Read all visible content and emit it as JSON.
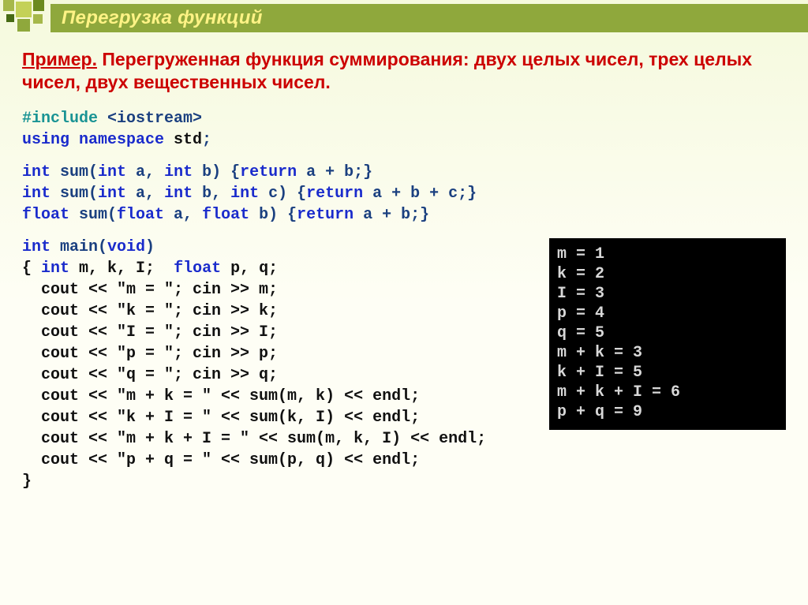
{
  "header": {
    "title": "Перегрузка функций"
  },
  "example": {
    "label": "Пример.",
    "text": " Перегруженная функция суммирования: двух целых чисел, трех целых чисел, двух вещественных чисел."
  },
  "code": {
    "l1a": "#include ",
    "l1b": "<iostream>",
    "l2a": "using namespace ",
    "l2b": "std",
    "l2c": ";",
    "l3a": "int ",
    "l3b": "sum(",
    "l3c": "int",
    "l3d": " a, ",
    "l3e": "int",
    "l3f": " b) {",
    "l3g": "return",
    "l3h": " a + b;}",
    "l4a": "int ",
    "l4b": "sum(",
    "l4c": "int",
    "l4d": " a, ",
    "l4e": "int",
    "l4f": " b, ",
    "l4g": "int",
    "l4h": " c) {",
    "l4i": "return",
    "l4j": " a + b + c;}",
    "l5a": "float ",
    "l5b": "sum(",
    "l5c": "float",
    "l5d": " a, ",
    "l5e": "float",
    "l5f": " b) {",
    "l5g": "return",
    "l5h": " a + b;}",
    "l6a": "int ",
    "l6b": "main(",
    "l6c": "void",
    "l6d": ")",
    "l7a": "{ ",
    "l7b": "int",
    "l7c": " m, k, I;  ",
    "l7d": "float",
    "l7e": " p, q;",
    "l8": "  cout << \"m = \"; cin >> m;",
    "l9": "  cout << \"k = \"; cin >> k;",
    "l10": "  cout << \"I = \"; cin >> I;",
    "l11": "  cout << \"p = \"; cin >> p;",
    "l12": "  cout << \"q = \"; cin >> q;",
    "l13": "  cout << \"m + k = \" << sum(m, k) << endl;",
    "l14": "  cout << \"k + I = \" << sum(k, I) << endl;",
    "l15": "  cout << \"m + k + I = \" << sum(m, k, I) << endl;",
    "l16": "  cout << \"p + q = \" << sum(p, q) << endl;",
    "l17": "}"
  },
  "console": "m = 1\nk = 2\nI = 3\np = 4\nq = 5\nm + k = 3\nk + I = 5\nm + k + I = 6\np + q = 9"
}
